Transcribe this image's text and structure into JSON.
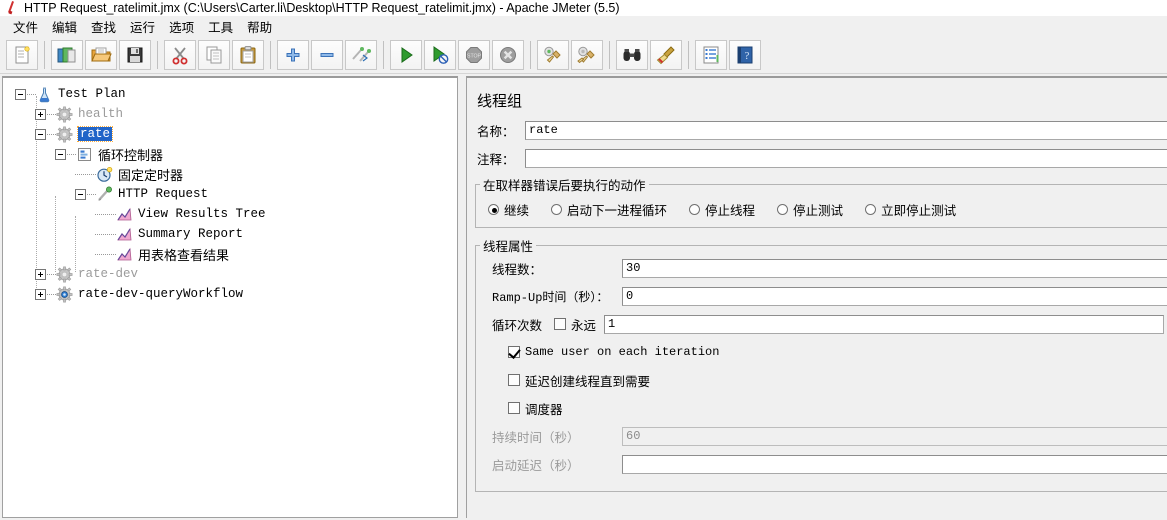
{
  "window": {
    "title": "HTTP Request_ratelimit.jmx (C:\\Users\\Carter.li\\Desktop\\HTTP Request_ratelimit.jmx) - Apache JMeter (5.5)",
    "icon": "pipette-icon"
  },
  "menubar": {
    "items": [
      {
        "label": "文件",
        "name": "menu-file"
      },
      {
        "label": "编辑",
        "name": "menu-edit"
      },
      {
        "label": "查找",
        "name": "menu-search"
      },
      {
        "label": "运行",
        "name": "menu-run"
      },
      {
        "label": "选项",
        "name": "menu-options"
      },
      {
        "label": "工具",
        "name": "menu-tools"
      },
      {
        "label": "帮助",
        "name": "menu-help"
      }
    ]
  },
  "toolbar": {
    "buttons": [
      {
        "icon": "new-document-icon",
        "group": 0
      },
      {
        "icon": "templates-icon",
        "group": 1
      },
      {
        "icon": "open-folder-icon",
        "group": 1
      },
      {
        "icon": "save-icon",
        "group": 1
      },
      {
        "icon": "cut-scissors-icon",
        "group": 2
      },
      {
        "icon": "copy-icon",
        "group": 2
      },
      {
        "icon": "paste-clipboard-icon",
        "group": 2
      },
      {
        "icon": "expand-plus-icon",
        "group": 3
      },
      {
        "icon": "collapse-minus-icon",
        "group": 3
      },
      {
        "icon": "toggle-enabled-icon",
        "group": 3
      },
      {
        "icon": "start-play-icon",
        "group": 4
      },
      {
        "icon": "start-no-timers-icon",
        "group": 4
      },
      {
        "icon": "stop-icon",
        "group": 4
      },
      {
        "icon": "shutdown-icon",
        "group": 4
      },
      {
        "icon": "clear-icon",
        "group": 5
      },
      {
        "icon": "clear-all-icon",
        "group": 5
      },
      {
        "icon": "search-binoculars-icon",
        "group": 6
      },
      {
        "icon": "reset-search-broom-icon",
        "group": 6
      },
      {
        "icon": "function-helper-icon",
        "group": 7
      },
      {
        "icon": "help-book-icon",
        "group": 7
      }
    ]
  },
  "tree": {
    "nodes": [
      {
        "label": "Test Plan",
        "icon": "test-plan-icon",
        "depth": 0,
        "handle": "minus",
        "state": "normal",
        "cjk": false,
        "selected": false
      },
      {
        "label": "health",
        "icon": "thread-group-icon-disabled",
        "depth": 1,
        "handle": "plus",
        "state": "disabled",
        "cjk": false,
        "selected": false
      },
      {
        "label": "rate",
        "icon": "thread-group-icon-disabled",
        "depth": 1,
        "handle": "minus",
        "state": "normal",
        "cjk": false,
        "selected": true
      },
      {
        "label": "循环控制器",
        "icon": "loop-controller-icon",
        "depth": 2,
        "handle": "minus",
        "state": "normal",
        "cjk": true,
        "selected": false
      },
      {
        "label": "固定定时器",
        "icon": "timer-icon",
        "depth": 3,
        "handle": "none",
        "state": "normal",
        "cjk": true,
        "selected": false
      },
      {
        "label": "HTTP Request",
        "icon": "http-sampler-icon",
        "depth": 3,
        "handle": "minus",
        "state": "normal",
        "cjk": false,
        "selected": false
      },
      {
        "label": "View Results Tree",
        "icon": "listener-icon",
        "depth": 4,
        "handle": "none",
        "state": "normal",
        "cjk": false,
        "selected": false
      },
      {
        "label": "Summary Report",
        "icon": "listener-icon",
        "depth": 4,
        "handle": "none",
        "state": "normal",
        "cjk": false,
        "selected": false
      },
      {
        "label": "用表格查看结果",
        "icon": "listener-icon",
        "depth": 4,
        "handle": "none",
        "state": "normal",
        "cjk": true,
        "selected": false
      },
      {
        "label": "rate-dev",
        "icon": "thread-group-icon-disabled",
        "depth": 1,
        "handle": "plus",
        "state": "disabled",
        "cjk": false,
        "selected": false
      },
      {
        "label": "rate-dev-queryWorkflow",
        "icon": "thread-group-icon-enabled",
        "depth": 1,
        "handle": "plus",
        "state": "normal",
        "cjk": false,
        "selected": false
      }
    ]
  },
  "panel": {
    "title": "线程组",
    "name_label": "名称：",
    "name_value": "rate",
    "comment_label": "注释：",
    "comment_value": "",
    "on_error": {
      "legend": "在取样器错误后要执行的动作",
      "options": [
        {
          "label": "继续",
          "selected": true,
          "name": "radio-continue"
        },
        {
          "label": "启动下一进程循环",
          "selected": false,
          "name": "radio-start-next-loop"
        },
        {
          "label": "停止线程",
          "selected": false,
          "name": "radio-stop-thread"
        },
        {
          "label": "停止测试",
          "selected": false,
          "name": "radio-stop-test"
        },
        {
          "label": "立即停止测试",
          "selected": false,
          "name": "radio-stop-test-now"
        }
      ]
    },
    "thread_props": {
      "legend": "线程属性",
      "num_threads_label": "线程数：",
      "num_threads_value": "30",
      "rampup_label": "Ramp-Up时间（秒）：",
      "rampup_value": "0",
      "loop_count_label": "循环次数",
      "forever_label": "永远",
      "forever_checked": false,
      "loop_count_value": "1",
      "same_user_label": "Same user on each iteration",
      "same_user_checked": true,
      "delayed_start_label": "延迟创建线程直到需要",
      "delayed_start_checked": false,
      "scheduler_label": "调度器",
      "scheduler_checked": false,
      "duration_label": "持续时间（秒）",
      "duration_value": "60",
      "duration_enabled": false,
      "startup_delay_label": "启动延迟（秒）",
      "startup_delay_value": "",
      "startup_delay_enabled": false
    }
  },
  "colors": {
    "selection_blue": "#2064c8",
    "panel_bg": "#f0f0f0",
    "disabled_text": "#9b9b9b",
    "green_play": "#2e9b2e"
  }
}
